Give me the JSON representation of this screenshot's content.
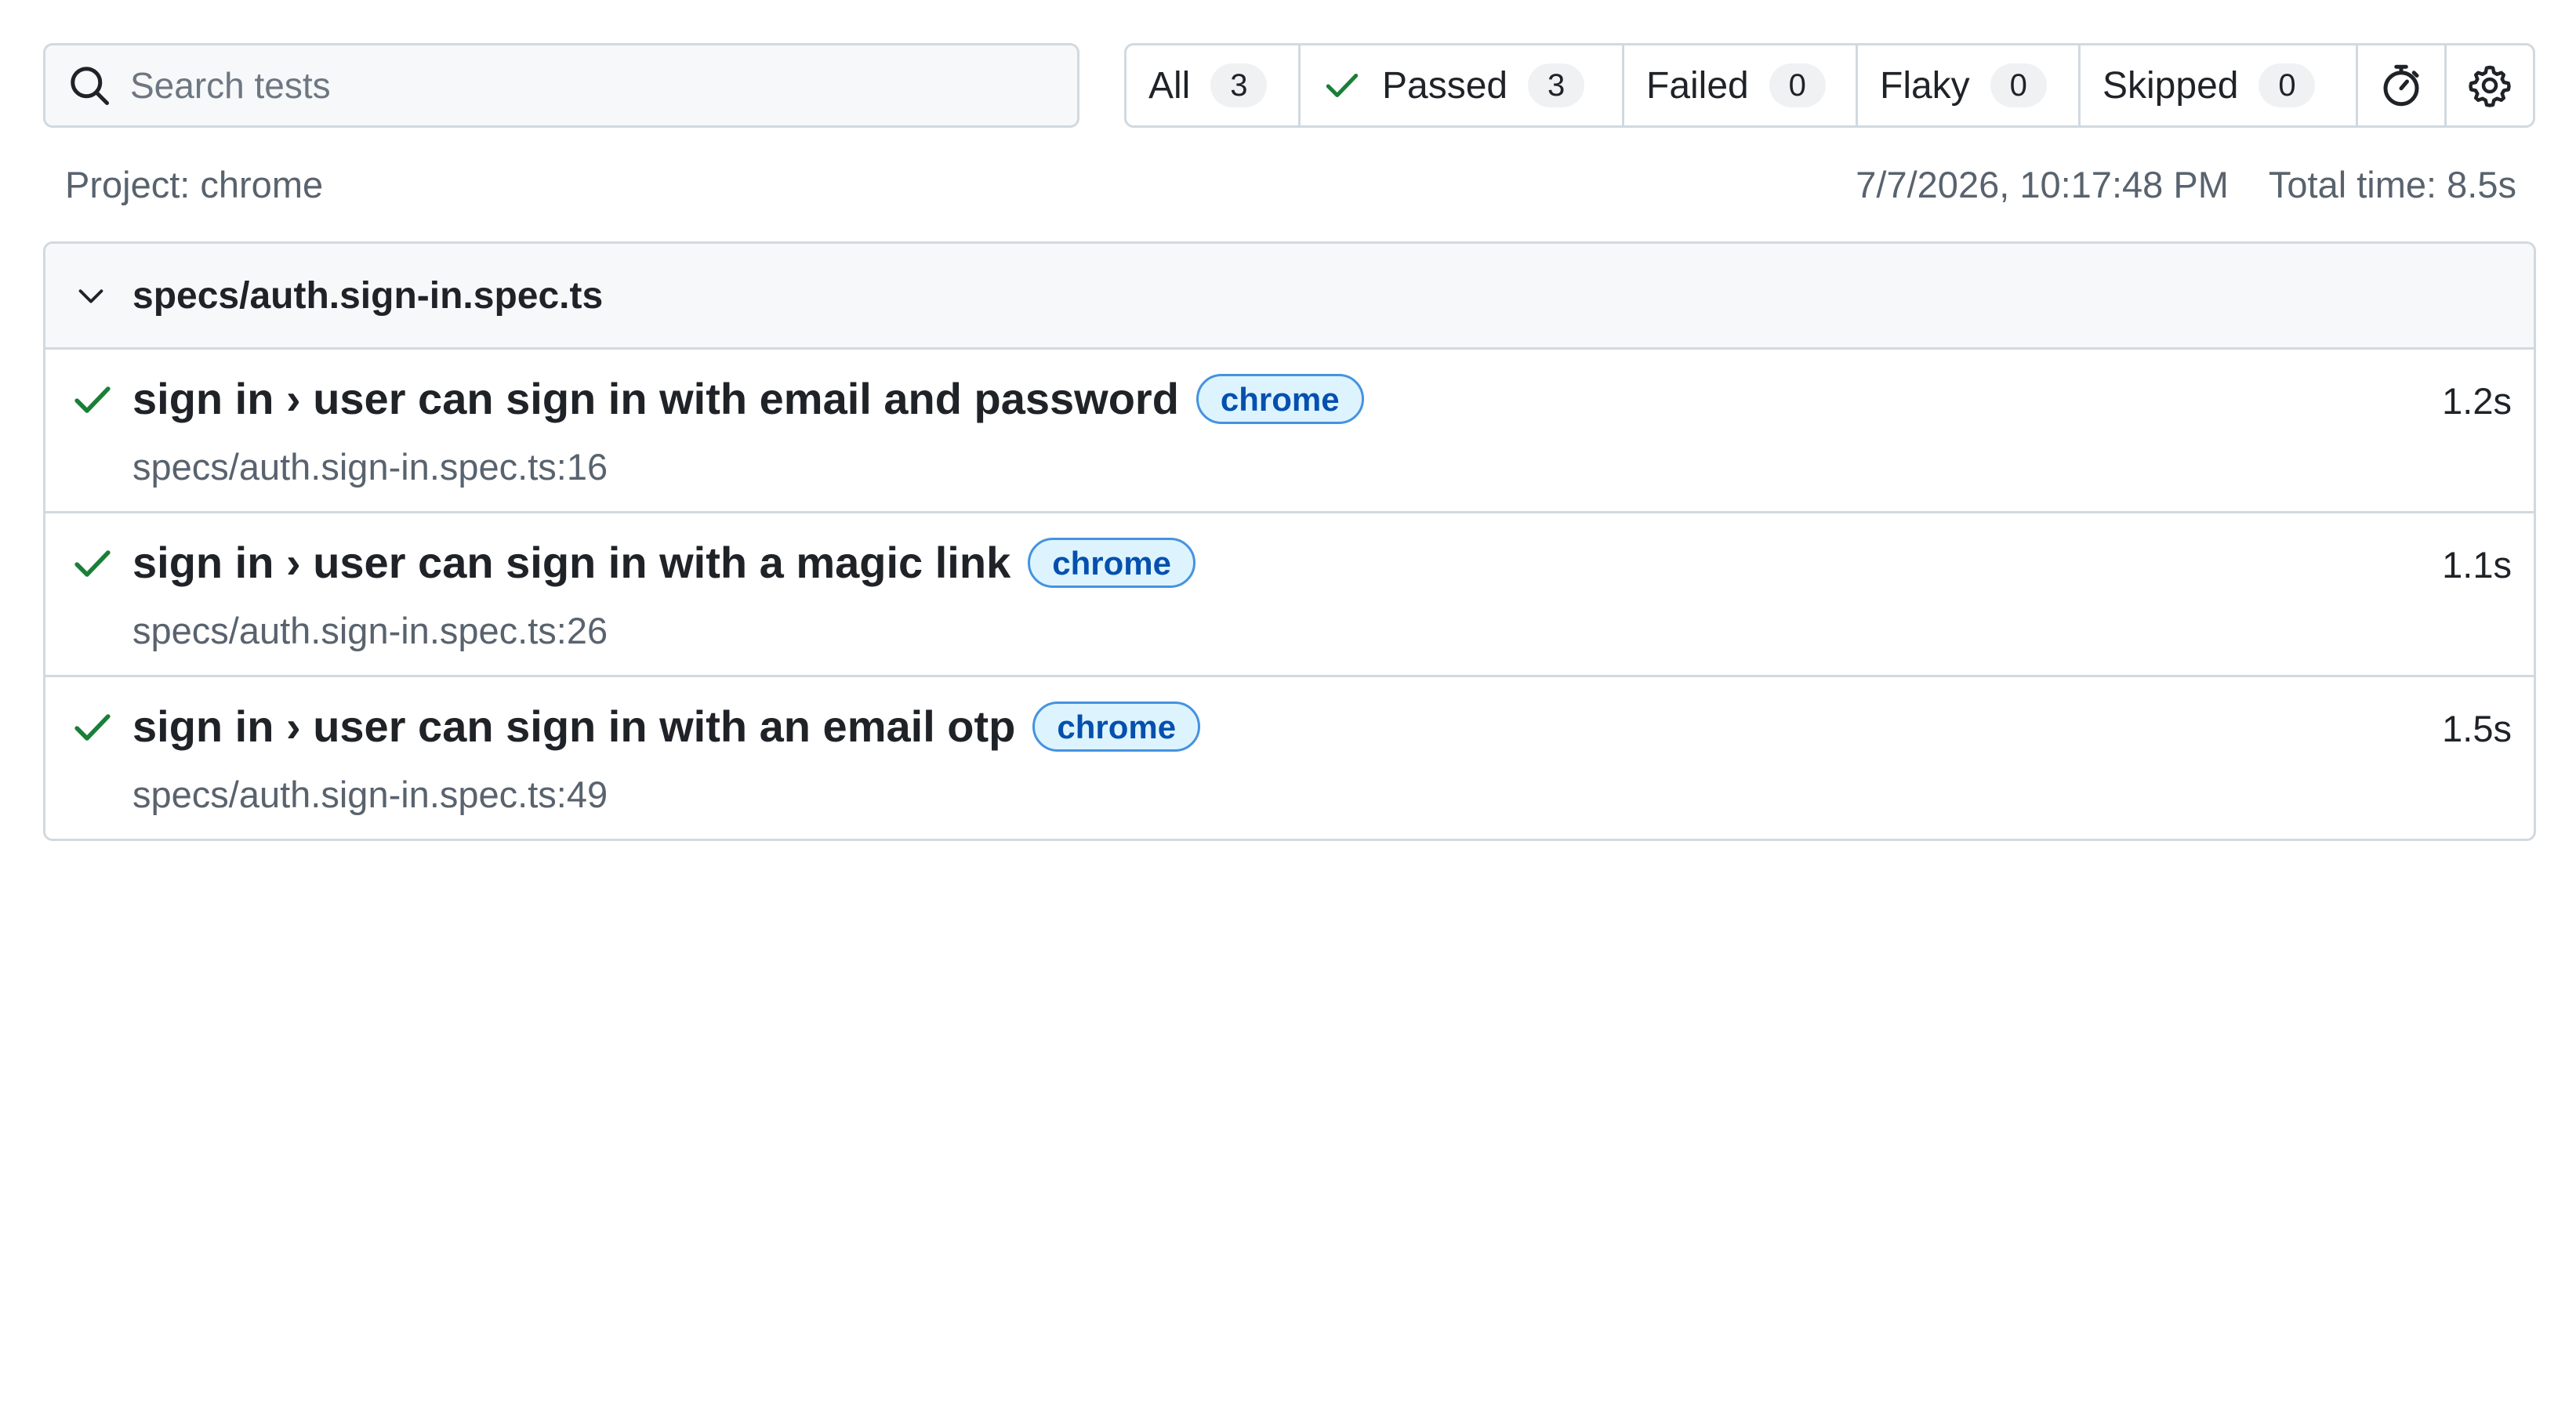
{
  "search": {
    "placeholder": "Search tests",
    "value": ""
  },
  "filters": [
    {
      "label": "All",
      "count": "3"
    },
    {
      "label": "Passed",
      "count": "3"
    },
    {
      "label": "Failed",
      "count": "0"
    },
    {
      "label": "Flaky",
      "count": "0"
    },
    {
      "label": "Skipped",
      "count": "0"
    }
  ],
  "meta": {
    "project": "Project: chrome",
    "datetime": "7/7/2026, 10:17:48 PM",
    "total_time": "Total time: 8.5s"
  },
  "file": {
    "title": "specs/auth.sign-in.spec.ts",
    "tests": [
      {
        "title": "sign in › user can sign in with email and password",
        "tag": "chrome",
        "location": "specs/auth.sign-in.spec.ts:16",
        "duration": "1.2s",
        "status": "passed"
      },
      {
        "title": "sign in › user can sign in with a magic link",
        "tag": "chrome",
        "location": "specs/auth.sign-in.spec.ts:26",
        "duration": "1.1s",
        "status": "passed"
      },
      {
        "title": "sign in › user can sign in with an email otp",
        "tag": "chrome",
        "location": "specs/auth.sign-in.spec.ts:49",
        "duration": "1.5s",
        "status": "passed"
      }
    ]
  },
  "colors": {
    "passed": "#1a7f37",
    "tag_bg": "#ddf4ff",
    "tag_border": "#4493e0",
    "tag_text": "#0550ae",
    "border": "#d1d9e0"
  },
  "icons": {
    "search": "search-icon",
    "passed": "check-icon",
    "timer": "stopwatch-icon",
    "settings": "gear-icon",
    "collapse": "chevron-down-icon"
  }
}
